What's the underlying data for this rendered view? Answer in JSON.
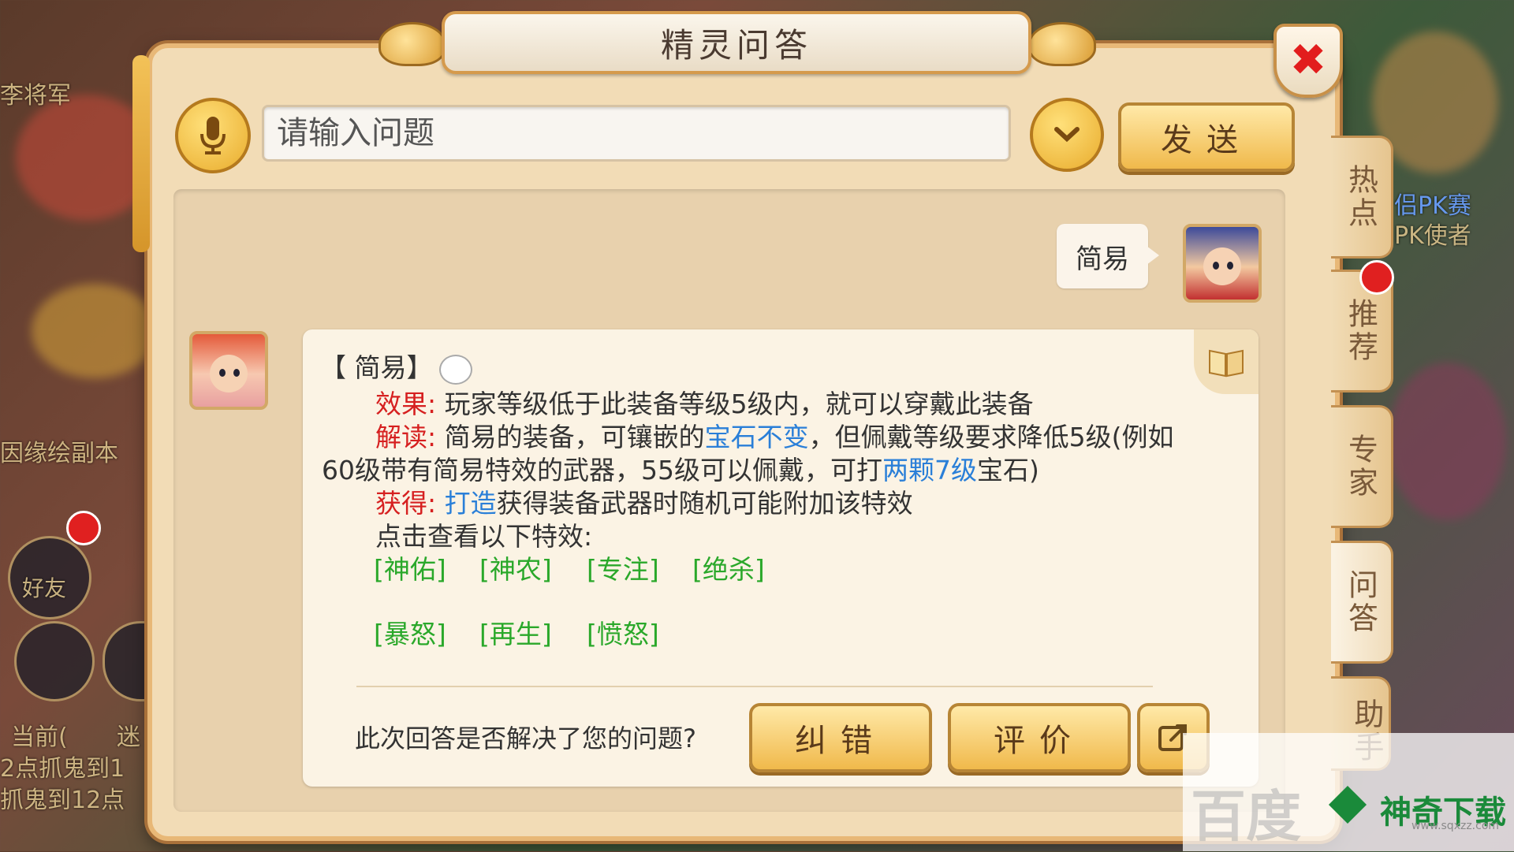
{
  "background": {
    "left_texts": [
      "李将军",
      "因缘绘副本",
      "好友",
      "当前(",
      "迷",
      "2点抓鬼到1",
      "抓鬼到12点"
    ],
    "right_texts": [
      "侣PK赛",
      "PK使者"
    ]
  },
  "window": {
    "title": "精灵问答"
  },
  "toolbar": {
    "input_placeholder": "请输入问题",
    "send_label": "发送"
  },
  "chat": {
    "user_message": "简易",
    "answer": {
      "header": "【 简易】",
      "effect_label": "效果:",
      "effect_text": "玩家等级低于此装备等级5级内，就可以穿戴此装备",
      "interpret_label": "解读:",
      "interpret_text_1": "简易的装备，可镶嵌的",
      "interpret_link_1": "宝石不变",
      "interpret_text_2": "，但佩戴等级要求降低5级(例如",
      "interpret_text_3": "60级带有简易特效的武器，55级可以佩戴，可打",
      "interpret_link_2": "两颗7级",
      "interpret_text_4": "宝石)",
      "obtain_label": "获得:",
      "obtain_link": "打造",
      "obtain_text": "获得装备武器时随机可能附加该特效",
      "click_hint": "点击查看以下特效:",
      "effects_row1": [
        "[神佑]",
        "[神农]",
        "[专注]",
        "[绝杀]"
      ],
      "effects_row2": [
        "[暴怒]",
        "[再生]",
        "[愤怒]"
      ]
    },
    "feedback_question": "此次回答是否解决了您的问题?",
    "correct_label": "纠错",
    "rate_label": "评价"
  },
  "side_tabs": [
    "热点",
    "推荐",
    "专家",
    "问答",
    "助手"
  ],
  "watermark": {
    "big_text": "百度",
    "logo_text": "神奇下载",
    "url": "www.sqxzz.com"
  },
  "colors": {
    "red_label": "#d62020",
    "link_blue": "#2a7fd8",
    "effect_green": "#2aa82a",
    "gold_button": "#f0b94b"
  }
}
